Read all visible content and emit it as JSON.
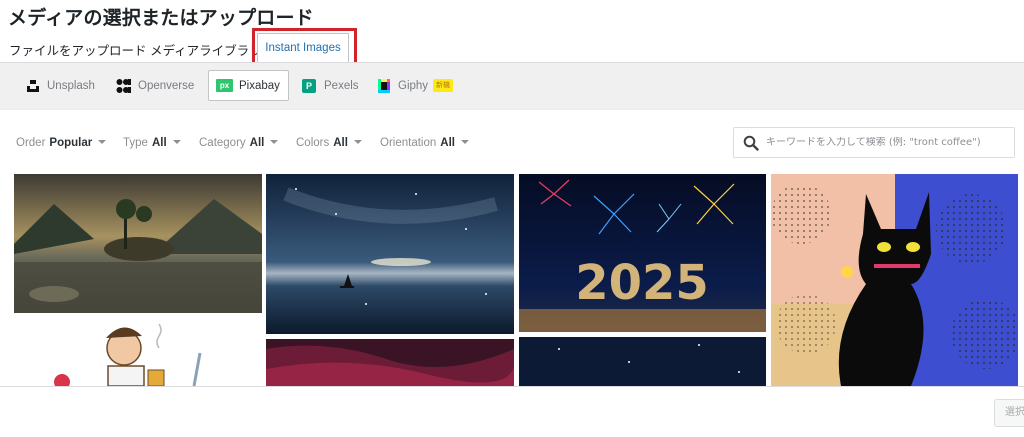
{
  "header": {
    "title": "メディアの選択またはアップロード"
  },
  "menu": {
    "upload_label": "ファイルをアップロード",
    "library_label": "メディアライブラリ",
    "instant_label": "Instant Images"
  },
  "providers": {
    "unsplash": "Unsplash",
    "openverse": "Openverse",
    "pixabay": "Pixabay",
    "pixabay_logo": "px",
    "pexels": "Pexels",
    "pexels_logo": "P",
    "giphy": "Giphy",
    "giphy_badge": "新機",
    "active": "Pixabay"
  },
  "filters": {
    "order_label": "Order",
    "order_value": "Popular",
    "type_label": "Type",
    "type_value": "All",
    "category_label": "Category",
    "category_value": "All",
    "colors_label": "Colors",
    "colors_value": "All",
    "orientation_label": "Orientation",
    "orientation_value": "All"
  },
  "search": {
    "placeholder": "キーワードを入力して検索 (例: \"tront coffee\")",
    "value": ""
  },
  "footer": {
    "select_label": "選択"
  },
  "colors": {
    "accent": "#2271b1",
    "highlight": "#d2232a",
    "pixabay": "#2ec66d",
    "pexels": "#05a081"
  },
  "icons": {
    "unsplash": "unsplash-icon",
    "openverse": "openverse-icon",
    "pixabay": "pixabay-icon",
    "pexels": "pexels-icon",
    "giphy": "giphy-icon",
    "search": "search-icon",
    "caret": "chevron-down-icon"
  }
}
